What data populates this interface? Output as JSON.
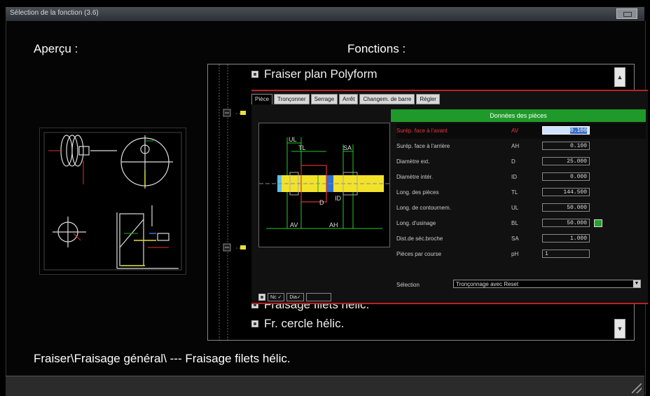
{
  "window": {
    "title": "Sélection de la fonction (3.6)"
  },
  "apercu_label": "Aperçu :",
  "fonctions_label": "Fonctions :",
  "tree": {
    "items": [
      {
        "label": "Fraiser plan Polyform"
      },
      {
        "label": "Fraisage filets hélic."
      },
      {
        "label": "Fr. cercle hélic."
      }
    ]
  },
  "panel": {
    "tabs": [
      "Pièce",
      "Tronçonner",
      "Serrage",
      "Arrêt",
      "Changem. de barre",
      "Régler"
    ],
    "header": "Données des pièces",
    "rows": [
      {
        "name": "Surép. face à l'avant",
        "sym": "AV",
        "value": "0.100"
      },
      {
        "name": "Surép. face à l'arrière",
        "sym": "AH",
        "value": "0.100"
      },
      {
        "name": "Diamètre ext.",
        "sym": "D",
        "value": "25.000"
      },
      {
        "name": "Diamètre intér.",
        "sym": "ID",
        "value": "0.000"
      },
      {
        "name": "Long. des pièces",
        "sym": "TL",
        "value": "144.500"
      },
      {
        "name": "Long. de contournem.",
        "sym": "UL",
        "value": "50.000"
      },
      {
        "name": "Long. d'usinage",
        "sym": "BL",
        "value": "50.000"
      },
      {
        "name": "Dist.de séc.broche",
        "sym": "SA",
        "value": "1.000"
      },
      {
        "name": "Pièces par course",
        "sym": "pH",
        "value": "1"
      }
    ],
    "selection_label": "Sélection",
    "selection_value": "Tronçonnage avec Reset",
    "bottom_buttons": [
      "Nc ✓",
      "Dia✓"
    ],
    "drawing_labels": [
      "UL",
      "TL",
      "SA",
      "AV",
      "AH",
      "D",
      "ID"
    ]
  },
  "path_text": "Fraiser\\Fraisage général\\ --- Fraisage filets hélic.",
  "colors": {
    "accent_green": "#1f9a2a",
    "accent_red": "#bb2222"
  }
}
